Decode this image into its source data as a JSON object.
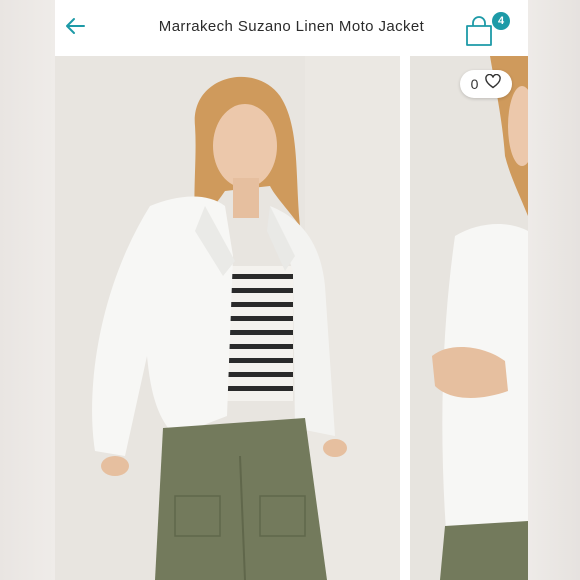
{
  "header": {
    "title": "Marrakech Suzano Linen Moto Jacket",
    "back_icon": "arrow-left-icon",
    "bag_icon": "shopping-bag-icon",
    "bag_count": "4"
  },
  "favorite": {
    "count": "0",
    "icon": "heart-icon"
  },
  "colors": {
    "accent": "#1d9aa7",
    "text": "#2b2b2b"
  }
}
